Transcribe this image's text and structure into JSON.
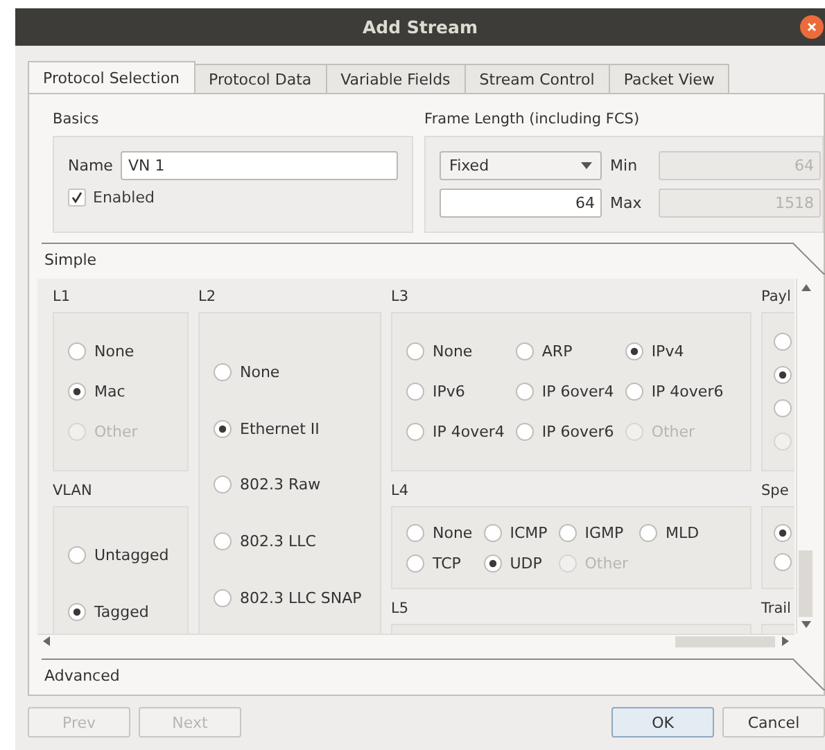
{
  "window": {
    "title": "Add Stream"
  },
  "tabs": [
    {
      "label": "Protocol Selection",
      "selected": true
    },
    {
      "label": "Protocol Data",
      "selected": false
    },
    {
      "label": "Variable Fields",
      "selected": false
    },
    {
      "label": "Stream Control",
      "selected": false
    },
    {
      "label": "Packet View",
      "selected": false
    }
  ],
  "basics": {
    "title": "Basics",
    "name_label": "Name",
    "name_value": "VN 1",
    "enabled": {
      "label": "Enabled",
      "checked": true
    }
  },
  "frame_length": {
    "title": "Frame Length (including FCS)",
    "mode": "Fixed",
    "value": "64",
    "min_label": "Min",
    "min_value": "64",
    "max_label": "Max",
    "max_value": "1518"
  },
  "simple_header": "Simple",
  "protocol_groups": {
    "l1": {
      "title": "L1",
      "options": [
        {
          "label": "None",
          "selected": false,
          "disabled": false
        },
        {
          "label": "Mac",
          "selected": true,
          "disabled": false
        },
        {
          "label": "Other",
          "selected": false,
          "disabled": true
        }
      ]
    },
    "vlan": {
      "title": "VLAN",
      "options": [
        {
          "label": "Untagged",
          "selected": false,
          "disabled": false
        },
        {
          "label": "Tagged",
          "selected": true,
          "disabled": false
        }
      ]
    },
    "l2": {
      "title": "L2",
      "options": [
        {
          "label": "None",
          "selected": false,
          "disabled": false
        },
        {
          "label": "Ethernet II",
          "selected": true,
          "disabled": false
        },
        {
          "label": "802.3 Raw",
          "selected": false,
          "disabled": false
        },
        {
          "label": "802.3 LLC",
          "selected": false,
          "disabled": false
        },
        {
          "label": "802.3 LLC SNAP",
          "selected": false,
          "disabled": false
        }
      ]
    },
    "l3": {
      "title": "L3",
      "options": [
        {
          "label": "None",
          "selected": false,
          "disabled": false
        },
        {
          "label": "ARP",
          "selected": false,
          "disabled": false
        },
        {
          "label": "IPv4",
          "selected": true,
          "disabled": false
        },
        {
          "label": "IPv6",
          "selected": false,
          "disabled": false
        },
        {
          "label": "IP 6over4",
          "selected": false,
          "disabled": false
        },
        {
          "label": "IP 4over6",
          "selected": false,
          "disabled": false
        },
        {
          "label": "IP 4over4",
          "selected": false,
          "disabled": false
        },
        {
          "label": "IP 6over6",
          "selected": false,
          "disabled": false
        },
        {
          "label": "Other",
          "selected": false,
          "disabled": true
        }
      ]
    },
    "l4": {
      "title": "L4",
      "options": [
        {
          "label": "None",
          "selected": false,
          "disabled": false
        },
        {
          "label": "ICMP",
          "selected": false,
          "disabled": false
        },
        {
          "label": "IGMP",
          "selected": false,
          "disabled": false
        },
        {
          "label": "MLD",
          "selected": false,
          "disabled": false
        },
        {
          "label": "TCP",
          "selected": false,
          "disabled": false
        },
        {
          "label": "UDP",
          "selected": true,
          "disabled": false
        },
        {
          "label": "Other",
          "selected": false,
          "disabled": true
        }
      ]
    },
    "l5": {
      "title": "L5"
    },
    "payload": {
      "title": "Payl",
      "options": [
        {
          "selected": false,
          "disabled": false
        },
        {
          "selected": true,
          "disabled": false
        },
        {
          "selected": false,
          "disabled": false
        },
        {
          "selected": false,
          "disabled": true
        }
      ]
    },
    "special": {
      "title": "Spe",
      "options": [
        {
          "selected": true,
          "disabled": false
        },
        {
          "selected": false,
          "disabled": false
        }
      ]
    },
    "trailer": {
      "title": "Trail"
    }
  },
  "advanced_header": "Advanced",
  "buttons": [
    {
      "label": "Prev",
      "disabled": true,
      "default": false
    },
    {
      "label": "Next",
      "disabled": true,
      "default": false
    },
    {
      "label": "OK",
      "disabled": false,
      "default": true
    },
    {
      "label": "Cancel",
      "disabled": false,
      "default": false
    }
  ]
}
